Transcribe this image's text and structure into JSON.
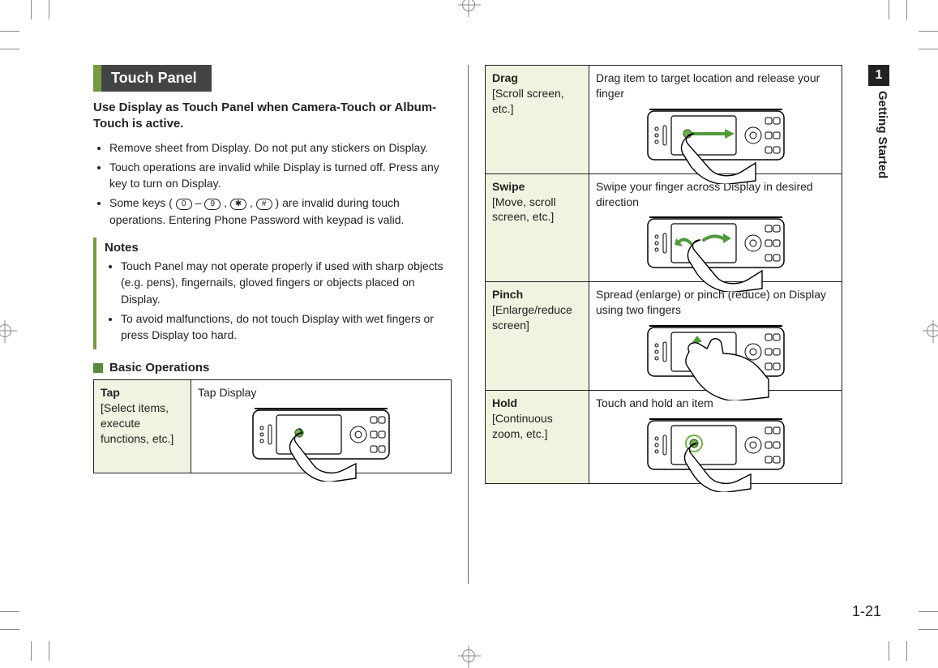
{
  "side": {
    "tab": "1",
    "label": "Getting Started"
  },
  "pageno": "1-21",
  "section_title": "Touch Panel",
  "lead": "Use Display as Touch Panel when Camera-Touch or Album-Touch is active.",
  "bullets": {
    "b1": "Remove sheet from Display. Do not put any stickers on Display.",
    "b2": "Touch operations are invalid while Display is turned off. Press any key to turn on Display.",
    "b3_pre": "Some keys (",
    "b3_mid1": " – ",
    "b3_mid2": ", ",
    "b3_mid3": ", ",
    "b3_post": ") are invalid during touch operations. Entering Phone Password with keypad is valid.",
    "k0": "0",
    "k9": "9",
    "kstar": "✱",
    "khash": "#"
  },
  "notes": {
    "title": "Notes",
    "n1": "Touch Panel may not operate properly if used with sharp objects (e.g. pens), fingernails, gloved fingers or objects placed on Display.",
    "n2": "To avoid malfunctions, do not touch Display with wet fingers or press Display too hard."
  },
  "subhead": "Basic Operations",
  "ops": {
    "tap": {
      "name": "Tap",
      "hint": "[Select items, execute functions, etc.]",
      "desc": "Tap Display"
    },
    "drag": {
      "name": "Drag",
      "hint": "[Scroll screen, etc.]",
      "desc": "Drag item to target location and release your finger"
    },
    "swipe": {
      "name": "Swipe",
      "hint": "[Move, scroll screen, etc.]",
      "desc": "Swipe your finger across Display in desired direction"
    },
    "pinch": {
      "name": "Pinch",
      "hint": "[Enlarge/reduce screen]",
      "desc": "Spread (enlarge) or pinch (reduce) on Display using two fingers"
    },
    "hold": {
      "name": "Hold",
      "hint": "[Continuous zoom, etc.]",
      "desc": "Touch and hold an item"
    }
  }
}
